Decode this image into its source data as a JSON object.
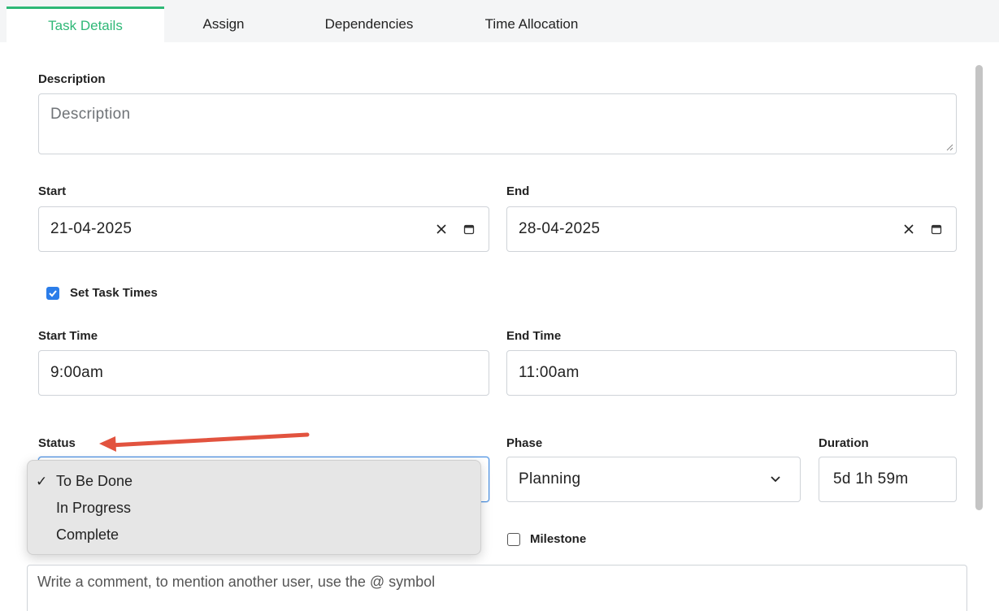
{
  "tabs": [
    {
      "label": "Task Details",
      "active": true
    },
    {
      "label": "Assign",
      "active": false
    },
    {
      "label": "Dependencies",
      "active": false
    },
    {
      "label": "Time Allocation",
      "active": false
    }
  ],
  "description": {
    "label": "Description",
    "placeholder": "Description",
    "value": ""
  },
  "start": {
    "label": "Start",
    "value": "21-04-2025"
  },
  "end": {
    "label": "End",
    "value": "28-04-2025"
  },
  "set_task_times": {
    "label": "Set Task Times",
    "checked": true
  },
  "start_time": {
    "label": "Start Time",
    "value": "9:00am"
  },
  "end_time": {
    "label": "End Time",
    "value": "11:00am"
  },
  "status": {
    "label": "Status",
    "options": [
      {
        "label": "To Be Done",
        "selected": true
      },
      {
        "label": "In Progress",
        "selected": false
      },
      {
        "label": "Complete",
        "selected": false
      }
    ],
    "check_glyph": "✓"
  },
  "phase": {
    "label": "Phase",
    "value": "Planning"
  },
  "duration": {
    "label": "Duration",
    "value": "5d 1h 59m"
  },
  "milestone": {
    "label": "Milestone",
    "checked": false
  },
  "comment": {
    "placeholder": "Write a comment, to mention another user, use the @ symbol"
  },
  "colors": {
    "accent_green": "#2fb877",
    "checkbox_blue": "#2b7de9",
    "focus_blue": "#4a90e2",
    "annotation_red": "#e2533f"
  },
  "icons": [
    "clear-icon",
    "calendar-icon",
    "chevron-down-icon",
    "checkmark-icon",
    "annotation-arrow"
  ]
}
